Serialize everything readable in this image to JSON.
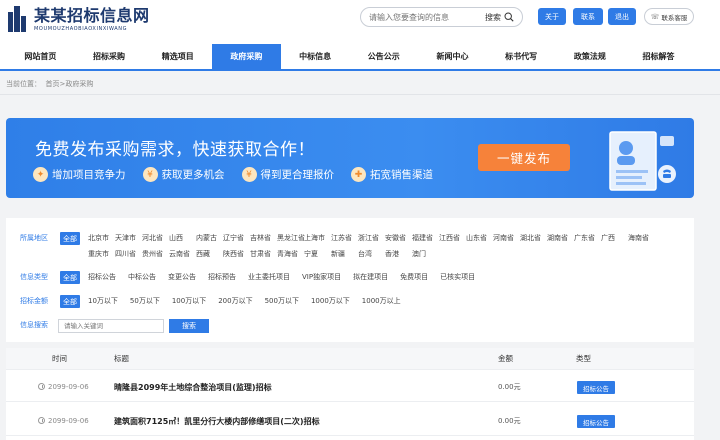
{
  "header": {
    "logo_cn": "某某招标信息网",
    "logo_en": "MOUMOUZHAOBIAOXINXIWANG",
    "search_placeholder": "请输入您要查询的信息",
    "search_button": "搜索",
    "about_label": "关于",
    "contact_label": "联系",
    "logout_label": "退出",
    "service_label": "联系客服"
  },
  "nav": {
    "items": [
      "网站首页",
      "招标采购",
      "精选项目",
      "政府采购",
      "中标信息",
      "公告公示",
      "新闻中心",
      "标书代写",
      "政策法规",
      "招标解答"
    ],
    "active_index": 3
  },
  "breadcrumb": {
    "prefix": "当前位置：",
    "home": "首页",
    "sep": ">",
    "current": "政府采购"
  },
  "banner": {
    "title": "免费发布采购需求，快速获取合作！",
    "features": [
      "增加项目竞争力",
      "获取更多机会",
      "得到更合理报价",
      "拓宽销售渠道"
    ],
    "button_label": "一键发布"
  },
  "filters": {
    "area": {
      "label": "所属地区",
      "all": "全部",
      "options": [
        "北京市",
        "天津市",
        "河北省",
        "山西",
        "内蒙古",
        "辽宁省",
        "吉林省",
        "黑龙江省",
        "上海市",
        "江苏省",
        "浙江省",
        "安徽省",
        "福建省",
        "江西省",
        "山东省",
        "河南省",
        "湖北省",
        "湖南省",
        "广东省",
        "广西",
        "海南省",
        "重庆市",
        "四川省",
        "贵州省",
        "云南省",
        "西藏",
        "陕西省",
        "甘肃省",
        "青海省",
        "宁夏",
        "新疆",
        "台湾",
        "香港",
        "澳门"
      ]
    },
    "type": {
      "label": "信息类型",
      "all": "全部",
      "options": [
        "招标公告",
        "中标公告",
        "变更公告",
        "招标预告",
        "业主委托项目",
        "VIP独家项目",
        "拟在建项目",
        "免费项目",
        "已核实项目"
      ]
    },
    "amount": {
      "label": "招标金额",
      "all": "全部",
      "options": [
        "10万以下",
        "50万以下",
        "100万以下",
        "200万以下",
        "500万以下",
        "1000万以下",
        "1000万以上"
      ]
    },
    "keyword": {
      "label": "信息搜索",
      "placeholder": "请输入关键词",
      "button": "搜索"
    }
  },
  "table": {
    "headers": {
      "time": "时间",
      "title": "标题",
      "amount": "金额",
      "type": "类型"
    },
    "rows": [
      {
        "date": "2099-09-06",
        "title": "晴隆县2099年土地综合整治项目(监理)招标",
        "amount": "0.00元",
        "type": "招标公告"
      },
      {
        "date": "2099-09-06",
        "title": "建筑面积7125㎡！凯里分行大楼内部修缮项目(二次)招标",
        "amount": "0.00元",
        "type": "招标公告"
      }
    ]
  },
  "colors": {
    "primary": "#2f7be6",
    "orange": "#f6823a",
    "logo": "#1e3a6f"
  }
}
